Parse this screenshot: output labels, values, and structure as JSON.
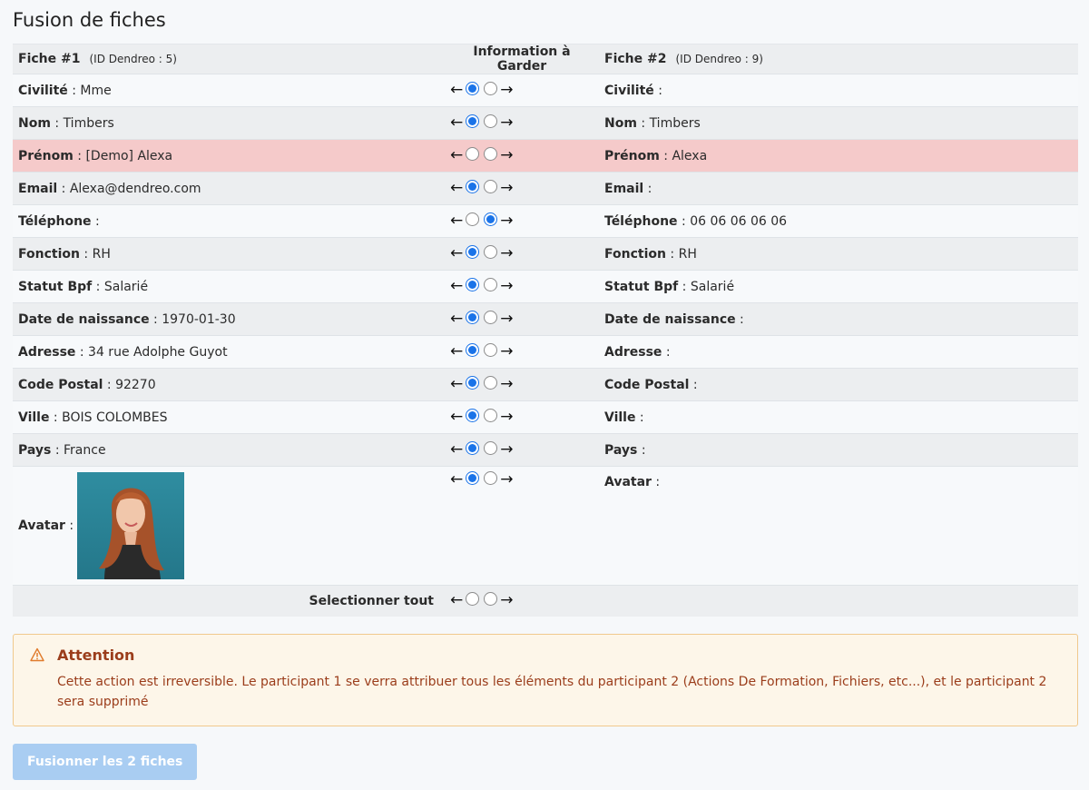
{
  "page": {
    "title": "Fusion de fiches"
  },
  "header": {
    "left_title": "Fiche #1",
    "left_id": "(ID Dendreo : 5)",
    "middle": "Information à Garder",
    "right_title": "Fiche #2",
    "right_id": "(ID Dendreo : 9)"
  },
  "rows": [
    {
      "label": "Civilité",
      "left": "Mme",
      "right": "",
      "choice": "left"
    },
    {
      "label": "Nom",
      "left": "Timbers",
      "right": "Timbers",
      "choice": "left"
    },
    {
      "label": "Prénom",
      "left": "[Demo] Alexa",
      "right": "Alexa",
      "choice": "none"
    },
    {
      "label": "Email",
      "left": "Alexa@dendreo.com",
      "right": "",
      "choice": "left"
    },
    {
      "label": "Téléphone",
      "left": "",
      "right": "06 06 06 06 06",
      "choice": "right"
    },
    {
      "label": "Fonction",
      "left": "RH",
      "right": "RH",
      "choice": "left"
    },
    {
      "label": "Statut Bpf",
      "left": "Salarié",
      "right": "Salarié",
      "choice": "left"
    },
    {
      "label": "Date de naissance",
      "left": "1970-01-30",
      "right": "",
      "choice": "left"
    },
    {
      "label": "Adresse",
      "left": "34 rue Adolphe Guyot",
      "right": "",
      "choice": "left"
    },
    {
      "label": "Code Postal",
      "left": "92270",
      "right": "",
      "choice": "left"
    },
    {
      "label": "Ville",
      "left": "BOIS COLOMBES",
      "right": "",
      "choice": "left"
    },
    {
      "label": "Pays",
      "left": "France",
      "right": "",
      "choice": "left"
    }
  ],
  "avatar_row": {
    "label": "Avatar",
    "right_label": "Avatar",
    "choice": "left"
  },
  "select_all": {
    "label": "Selectionner tout",
    "choice": "none"
  },
  "sep": " : ",
  "alert": {
    "title": "Attention",
    "text": "Cette action est irreversible. Le participant 1 se verra attribuer tous les éléments du participant 2 (Actions De Formation, Fichiers, etc...), et le participant 2 sera supprimé"
  },
  "merge_button": {
    "label": "Fusionner les 2 fiches"
  },
  "colors": {
    "accent": "#1a73e8",
    "highlight_row": "#f5caca",
    "alert_bg": "#fdf6e9",
    "alert_text": "#9b3d1b",
    "button_bg": "#a9cdf2"
  }
}
